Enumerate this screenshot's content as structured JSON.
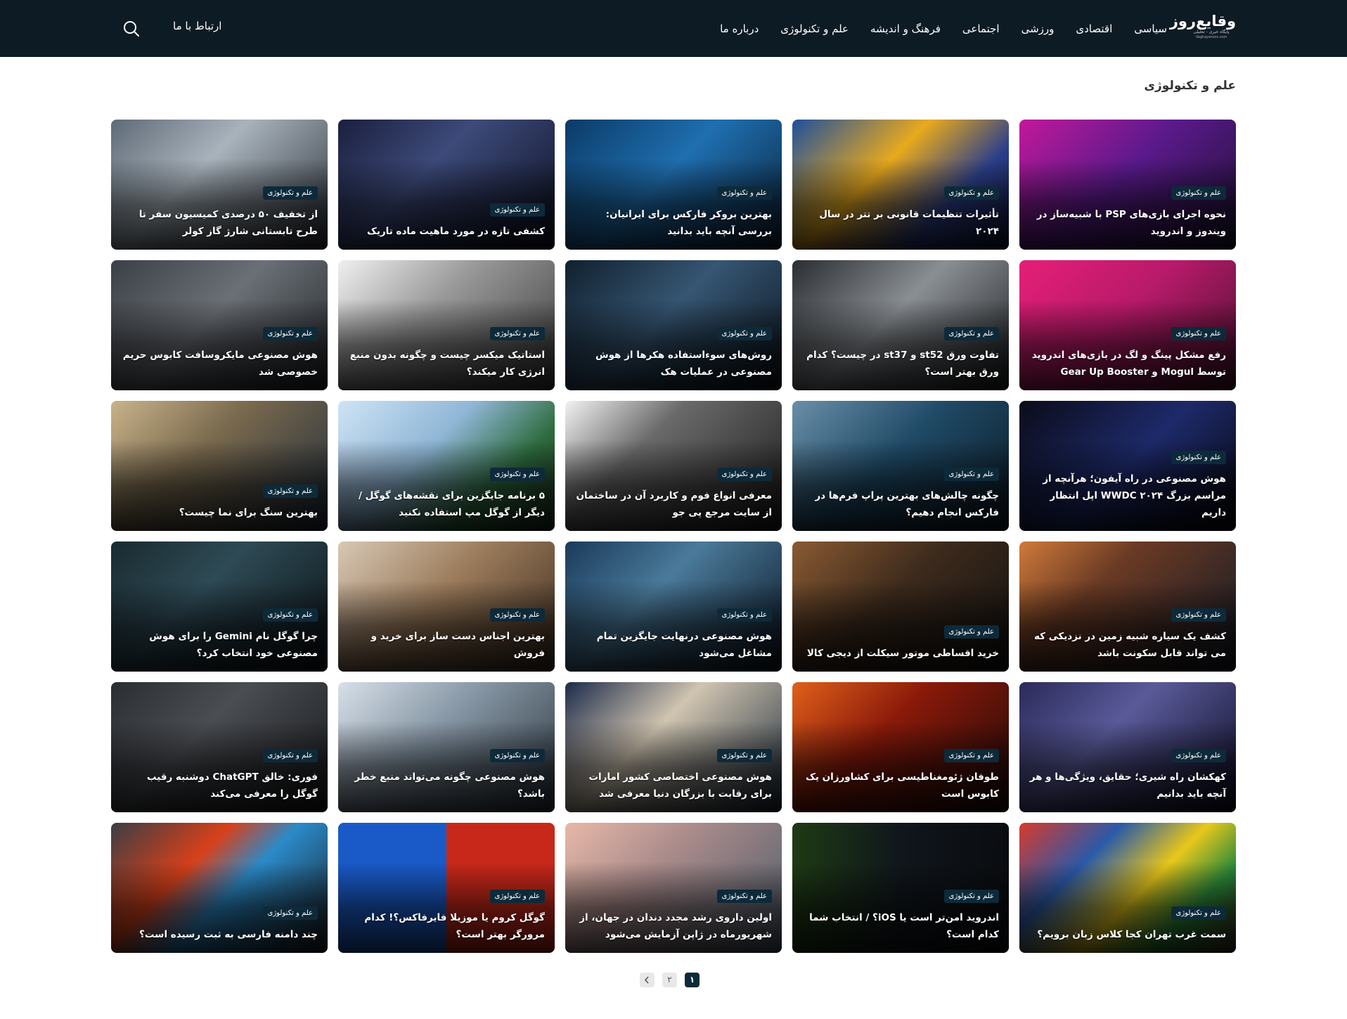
{
  "header": {
    "logo_main": "وقایع‌روز",
    "logo_sub": "پایگاه خبری - تحلیلی",
    "logo_url": "Vaghayerooz.com",
    "nav": [
      "سیاسی",
      "اقتصادی",
      "ورزشی",
      "اجتماعی",
      "فرهنگ و اندیشه",
      "علم و تکنولوژی",
      "درباره ما"
    ],
    "contact": "ارتباط با ما",
    "search_icon": "search-icon"
  },
  "page_title": "علم و تکنولوژی",
  "category_label": "علم و تکنولوژی",
  "cards": [
    {
      "title": "نحوه اجرای بازی‌های PSP با شبیه‌ساز در ویندوز و اندروید",
      "bg": "linear-gradient(135deg,#c2189a 0%,#5b1a8c 45%,#1b1030 100%)"
    },
    {
      "title": "تأثیرات تنظیمات قانونی بر تتر در سال ۲۰۲۴",
      "bg": "linear-gradient(135deg,#1d4f9c 0%,#e8a91c 40%,#2b3f8a 70%,#0d1430 100%)"
    },
    {
      "title": "بهترین بروکر فارکس برای ایرانیان: بررسی آنچه باید بدانید",
      "bg": "linear-gradient(135deg,#0b3a66 0%,#1f6fb0 45%,#0a2238 100%)"
    },
    {
      "title": "کشفی تازه در مورد ماهیت ماده تاریک",
      "bg": "linear-gradient(135deg,#1a1f3d 0%,#3d4a7a 40%,#0b0f20 100%)"
    },
    {
      "title": "از تخفیف ۵۰ درصدی کمیسیون سفر تا طرح تابستانی شارژ گاز کولر",
      "bg": "linear-gradient(135deg,#5e6a77 0%,#a9b3bc 40%,#2a3038 100%)"
    },
    {
      "title": "رفع مشکل پینگ و لگ در بازی‌های اندروید توسط Mogul و Gear Up Booster",
      "bg": "linear-gradient(135deg,#e61f78 0%,#b81a6a 45%,#4a1230 100%)"
    },
    {
      "title": "تفاوت ورق st52 و st37 در چیست؟ کدام ورق بهتر است؟",
      "bg": "linear-gradient(135deg,#2a2d31 0%,#8a8f94 45%,#1b1d20 100%)"
    },
    {
      "title": "روش‌های سوءاستفاده هکرها از هوش مصنوعی در عملیات هک",
      "bg": "linear-gradient(135deg,#10202e 0%,#365673 45%,#0a131c 100%)"
    },
    {
      "title": "استاتیک میکسر چیست و چگونه بدون منبع انرژی کار میکند؟",
      "bg": "linear-gradient(135deg,#f0f0f0 0%,#9a9a9a 40%,#3a3a3a 100%)"
    },
    {
      "title": "هوش مصنوعی مایکروسافت کابوس حریم خصوصی شد",
      "bg": "linear-gradient(135deg,#3b4046 0%,#6b7076 45%,#202428 100%)"
    },
    {
      "title": "هوش مصنوعی در راه آیفون؛ هرآنچه از مراسم بزرگ WWDC ۲۰۲۴ اپل انتظار داریم",
      "bg": "linear-gradient(135deg,#0b0b18 0%,#1d2a6a 50%,#050508 100%)"
    },
    {
      "title": "چگونه چالش‌های بهترین پراپ فرم‌ها در فارکس انجام دهیم؟",
      "bg": "linear-gradient(135deg,#6a8fa8 0%,#1f4a66 45%,#0b1822 100%)"
    },
    {
      "title": "معرفی انواع فوم و کاربرد آن در ساختمان از سایت مرجع پی جو",
      "bg": "linear-gradient(135deg,#f2f2f2 0%,#6a6a6a 35%,#1a1a1a 100%)"
    },
    {
      "title": "۵ برنامه جایگزین برای نقشه‌های گوگل / دیگر از گوگل مپ استفاده نکنید",
      "bg": "linear-gradient(135deg,#cfe4f5 0%,#8fb6d6 40%,#2e6c3e 70%,#1a2a20 100%)"
    },
    {
      "title": "بهترین سنگ برای نما چیست؟",
      "bg": "linear-gradient(135deg,#c9b38a 0%,#7a6a4e 40%,#1e2a3a 100%)"
    },
    {
      "title": "کشف یک سیاره شبیه زمین در نزدیکی که می تواند قابل سکونت باشد",
      "bg": "linear-gradient(135deg,#d07a3a 0%,#6a3a24 35%,#101826 100%)"
    },
    {
      "title": "خرید اقساطی موتور سیکلت از دیجی کالا",
      "bg": "linear-gradient(135deg,#8a5a32 0%,#3c2a1c 45%,#121010 100%)"
    },
    {
      "title": "هوش مصنوعی درنهایت جایگزین تمام مشاغل می‌شود",
      "bg": "linear-gradient(135deg,#1a3a5a 0%,#4a7a9a 40%,#0a1420 100%)"
    },
    {
      "title": "بهترین اجناس دست ساز برای خرید و فروش",
      "bg": "linear-gradient(135deg,#d8c8b4 0%,#9a7a5a 45%,#3a2a1e 100%)"
    },
    {
      "title": "چرا گوگل نام Gemini را برای هوش مصنوعی خود انتخاب کرد؟",
      "bg": "linear-gradient(135deg,#1a2a30 0%,#2e4a55 40%,#0a1014 100%)"
    },
    {
      "title": "کهکشان راه شیری؛ حقایق، ویژگی‌ها و هر آنچه باید بدانیم",
      "bg": "linear-gradient(135deg,#2a2a5a 0%,#5a5a9a 40%,#0a0a20 100%)"
    },
    {
      "title": "طوفان ژئومغناطیسی برای کشاورزان یک کابوس است",
      "bg": "linear-gradient(135deg,#e0601a 0%,#8a1a0a 40%,#1a0808 100%)"
    },
    {
      "title": "هوش مصنوعی اختصاصی کشور امارات برای رقابت با بزرگان دنیا معرفی شد",
      "bg": "linear-gradient(135deg,#1c2a4a 0%,#d0c4b0 40%,#1a2a3a 100%)"
    },
    {
      "title": "هوش مصنوعی چگونه می‌تواند منبع خطر باشد؟",
      "bg": "linear-gradient(135deg,#d8e0e8 0%,#8a9aa8 40%,#2a343e 100%)"
    },
    {
      "title": "فوری: خالق ChatGPT دوشنبه رقیب گوگل را معرفی می‌کند",
      "bg": "linear-gradient(135deg,#2a2d32 0%,#4a4d52 40%,#15171a 100%)"
    },
    {
      "title": "سمت غرب تهران کجا کلاس زبان برویم؟",
      "bg": "linear-gradient(135deg,#d83a2a 0%,#2a5aa8 30%,#e8c81a 55%,#2a8a3a 75%,#3a2a1a 100%)"
    },
    {
      "title": "اندروید امن‌تر است یا iOS؟ / انتخاب شما کدام است؟",
      "bg": "linear-gradient(90deg,#1e3a14 0%,#10161c 50%,#0a0c10 100%)"
    },
    {
      "title": "اولین داروی رشد مجدد دندان در جهان، از شهریورماه در ژاپن آزمایش می‌شود",
      "bg": "linear-gradient(135deg,#e8b8a8 0%,#a88a8a 40%,#4a5a6a 100%)"
    },
    {
      "title": "گوگل کروم یا موزیلا فایرفاکس؟! کدام مرورگر بهتر است؟",
      "bg": "linear-gradient(90deg,#1a5ac8 0%,#1a5ac8 50%,#c8281a 50%,#c8281a 100%)"
    },
    {
      "title": "چند دامنه فارسی به ثبت رسیده است؟",
      "bg": "linear-gradient(135deg,#3a3e44 0%,#d8401a 35%,#2a8ac8 55%,#1a1c20 100%)"
    }
  ],
  "pagination": {
    "pages": [
      "۱",
      "۲"
    ],
    "active": "۱",
    "next_icon": "chevron-left-icon"
  }
}
